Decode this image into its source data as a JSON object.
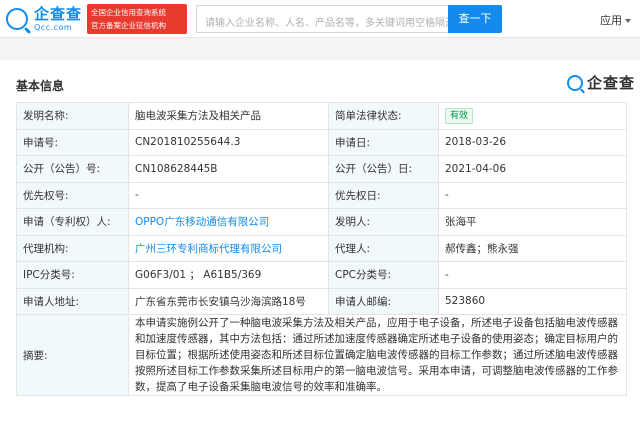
{
  "header": {
    "logo_name": "企查查",
    "logo_domain": "Qcc.com",
    "badge_line1": "全国企业信用查询系统",
    "badge_line2": "官方备案企业征信机构",
    "search_placeholder": "请输入企业名称、人名、产品名等，多关键词用空格隔开",
    "search_button": "查一下",
    "menu_app": "应用"
  },
  "section": {
    "title": "基本信息",
    "logo_text": "企查查"
  },
  "rows": [
    {
      "l1": "发明名称:",
      "v1": "脑电波采集方法及相关产品",
      "l2": "简单法律状态:",
      "v2": "有效"
    },
    {
      "l1": "申请号:",
      "v1": "CN201810255644.3",
      "l2": "申请日:",
      "v2": "2018-03-26"
    },
    {
      "l1": "公开（公告）号:",
      "v1": "CN108628445B",
      "l2": "公开（公告）日:",
      "v2": "2021-04-06"
    },
    {
      "l1": "优先权号:",
      "v1": "-",
      "l2": "优先权日:",
      "v2": "-"
    },
    {
      "l1": "申请（专利权）人:",
      "v1": "OPPO广东移动通信有限公司",
      "l2": "发明人:",
      "v2": "张海平"
    },
    {
      "l1": "代理机构:",
      "v1": "广州三环专利商标代理有限公司",
      "l2": "代理人:",
      "v2": "郝传鑫；熊永强"
    },
    {
      "l1": "IPC分类号:",
      "v1": "G06F3/01 ； A61B5/369",
      "l2": "CPC分类号:",
      "v2": "-"
    },
    {
      "l1": "申请人地址:",
      "v1": "广东省东莞市长安镇乌沙海滨路18号",
      "l2": "申请人邮编:",
      "v2": "523860"
    }
  ],
  "abstract": {
    "label": "摘要:",
    "text": "本申请实施例公开了一种脑电波采集方法及相关产品，应用于电子设备，所述电子设备包括脑电波传感器和加速度传感器，其中方法包括：通过所述加速度传感器确定所述电子设备的使用姿态；确定目标用户的目标位置；根据所述使用姿态和所述目标位置确定脑电波传感器的目标工作参数；通过所述脑电波传感器按照所述目标工作参数采集所述目标用户的第一脑电波信号。采用本申请，可调整脑电波传感器的工作参数，提高了电子设备采集脑电波信号的效率和准确率。"
  },
  "colors": {
    "brand": "#128bed",
    "badge_red": "#e63b2e",
    "label_bg": "#f2f9fc",
    "status_green": "#009944"
  }
}
